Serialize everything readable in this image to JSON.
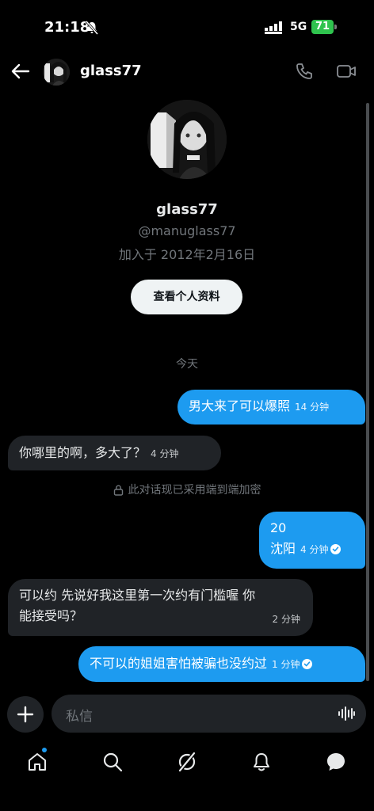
{
  "status_bar": {
    "time": "21:18",
    "network": "5G",
    "battery": "71"
  },
  "header": {
    "name": "glass77"
  },
  "profile": {
    "name": "glass77",
    "handle": "@manuglass77",
    "joined": "加入于 2012年2月16日",
    "view_profile_label": "查看个人资料"
  },
  "day_separator": "今天",
  "messages": [
    {
      "direction": "out",
      "text": "男大来了可以爆照",
      "time": "14 分钟"
    },
    {
      "direction": "in",
      "text": "你哪里的啊，多大了？",
      "time": "4 分钟"
    },
    {
      "direction": "out",
      "line1": "20",
      "line2": "沈阳",
      "time": "4 分钟"
    },
    {
      "direction": "in",
      "line1": "可以约 先说好我这里第一次约有门槛喔 你",
      "line2": "能接受吗？",
      "time": "2 分钟"
    },
    {
      "direction": "out",
      "text": "不可以的姐姐害怕被骗也没约过",
      "time": "1 分钟"
    }
  ],
  "encryption_notice": "此对话现已采用端到端加密",
  "composer": {
    "placeholder": "私信"
  },
  "colors": {
    "accent": "#1d9bf0",
    "incoming_bubble": "#202327",
    "battery": "#2fc34e"
  },
  "icons": {
    "nav": [
      "home-icon",
      "search-icon",
      "grok-icon",
      "notifications-icon",
      "messages-icon"
    ]
  }
}
